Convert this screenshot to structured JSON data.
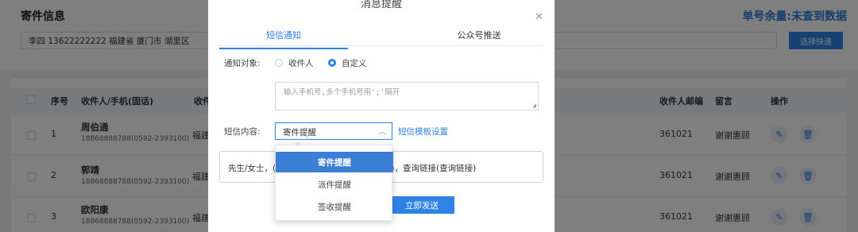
{
  "sender": {
    "title": "寄件信息",
    "quota": "单号余量:未查到数据",
    "address": "李四 13622222222  福建省 厦门市 湖里区",
    "choose_label": "选择快递"
  },
  "table": {
    "headers": {
      "seq": "序号",
      "receiver": "收件人/手机(固话)",
      "address": "收件",
      "zipcode": "收件人邮编",
      "note": "留言",
      "action": "操作"
    },
    "rows": [
      {
        "seq": "1",
        "name": "周伯通",
        "phone": "18868888788(0592-2393100)",
        "addr": "福建",
        "zip": "361021",
        "note": "谢谢惠顾"
      },
      {
        "seq": "2",
        "name": "郭靖",
        "phone": "18868888788(0592-2393100)",
        "addr": "福建",
        "zip": "361021",
        "note": "谢谢惠顾"
      },
      {
        "seq": "3",
        "name": "欧阳康",
        "phone": "18868888788(0592-2393100)",
        "addr": "福建",
        "zip": "361021",
        "note": "谢谢惠顾"
      }
    ]
  },
  "modal": {
    "title": "消息提醒",
    "tabs": [
      "短信通知",
      "公众号推送"
    ],
    "notify_label": "通知对象:",
    "radio_receiver": "收件人",
    "radio_custom": "自定义",
    "phone_placeholder": "输入手机号,多个手机号用';'隔开",
    "content_label": "短信内容:",
    "selected_template": "寄件提醒",
    "template_link": "短信模板设置",
    "preview_left": "先生/女士，(",
    "preview_right": "单号)，查询链接(查询链接)",
    "send_label": "立即发送"
  },
  "dropdown": {
    "options": [
      "寄件提醒",
      "派件提醒",
      "签收提醒"
    ],
    "selected": "寄件提醒"
  },
  "colors": {
    "accent": "#2f83e4",
    "overlay": "rgba(0,0,0,0.5)"
  }
}
